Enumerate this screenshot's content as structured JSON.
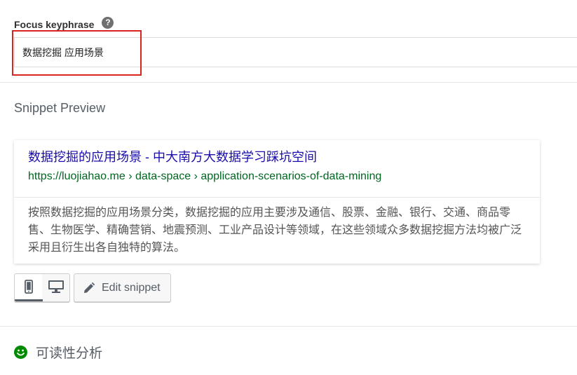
{
  "focus_keyphrase": {
    "label": "Focus keyphrase",
    "help_icon": "question-mark-icon",
    "help_glyph": "?",
    "value": "数据挖掘 应用场景"
  },
  "snippet_preview": {
    "heading": "Snippet Preview",
    "title": "数据挖掘的应用场景 - 中大南方大数据学习踩坑空间",
    "url": "https://luojiahao.me › data-space › application-scenarios-of-data-mining",
    "description": "按照数据挖掘的应用场景分类，数据挖掘的应用主要涉及通信、股票、金融、银行、交通、商品零售、生物医学、精确营销、地震预测、工业产品设计等领域，在这些领域众多数据挖掘方法均被广泛采用且衍生出各自独特的算法。",
    "colors": {
      "title": "#1a0dab",
      "url": "#006621",
      "description": "#545454"
    }
  },
  "toolbar": {
    "mobile_icon": "mobile-phone-icon",
    "desktop_icon": "desktop-monitor-icon",
    "active_mode": "mobile",
    "edit_icon": "pencil-icon",
    "edit_label": "Edit snippet"
  },
  "readability": {
    "icon": "smiley-face-icon",
    "status_color": "#008a00",
    "label": "可读性分析"
  },
  "highlight_color": "#d9251f"
}
